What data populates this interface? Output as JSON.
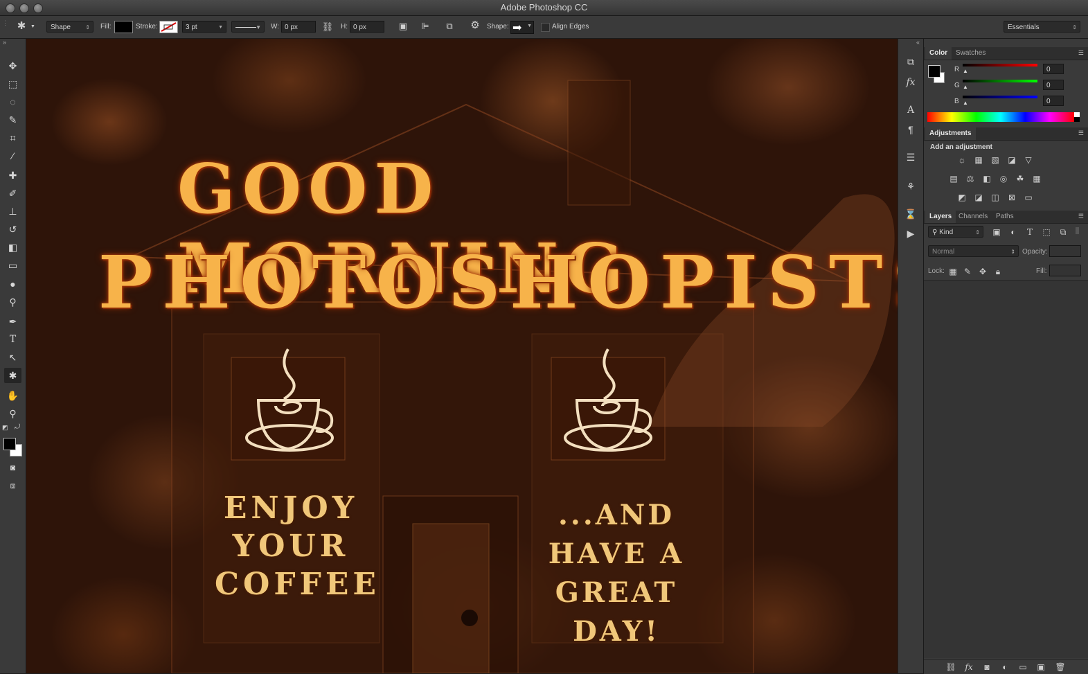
{
  "app": {
    "title": "Adobe Photoshop CC"
  },
  "options_bar": {
    "tool_mode": "Shape",
    "fill_label": "Fill:",
    "stroke_label": "Stroke:",
    "stroke_width": "3 pt",
    "width_label": "W:",
    "width_value": "0 px",
    "height_label": "H:",
    "height_value": "0 px",
    "shape_label": "Shape:",
    "align_edges_label": "Align Edges",
    "workspace": "Essentials"
  },
  "canvas": {
    "headline_line1": "GOOD MORNING",
    "headline_line2": "PHOTOSHOPISTS!",
    "left_lines": [
      "ENJOY",
      "YOUR",
      "COFFEE"
    ],
    "right_lines": [
      "...AND",
      "HAVE A",
      "GREAT DAY!"
    ]
  },
  "color_panel": {
    "tabs": [
      "Color",
      "Swatches"
    ],
    "r_label": "R",
    "g_label": "G",
    "b_label": "B",
    "r_value": "0",
    "g_value": "0",
    "b_value": "0"
  },
  "adjustments_panel": {
    "tab": "Adjustments",
    "heading": "Add an adjustment"
  },
  "layers_panel": {
    "tabs": [
      "Layers",
      "Channels",
      "Paths"
    ],
    "filter_kind": "Kind",
    "blend_mode": "Normal",
    "opacity_label": "Opacity:",
    "lock_label": "Lock:",
    "fill_label": "Fill:"
  },
  "colors": {
    "stroke_text": "#f7b34a",
    "panel_bg": "#3a3a3a"
  }
}
